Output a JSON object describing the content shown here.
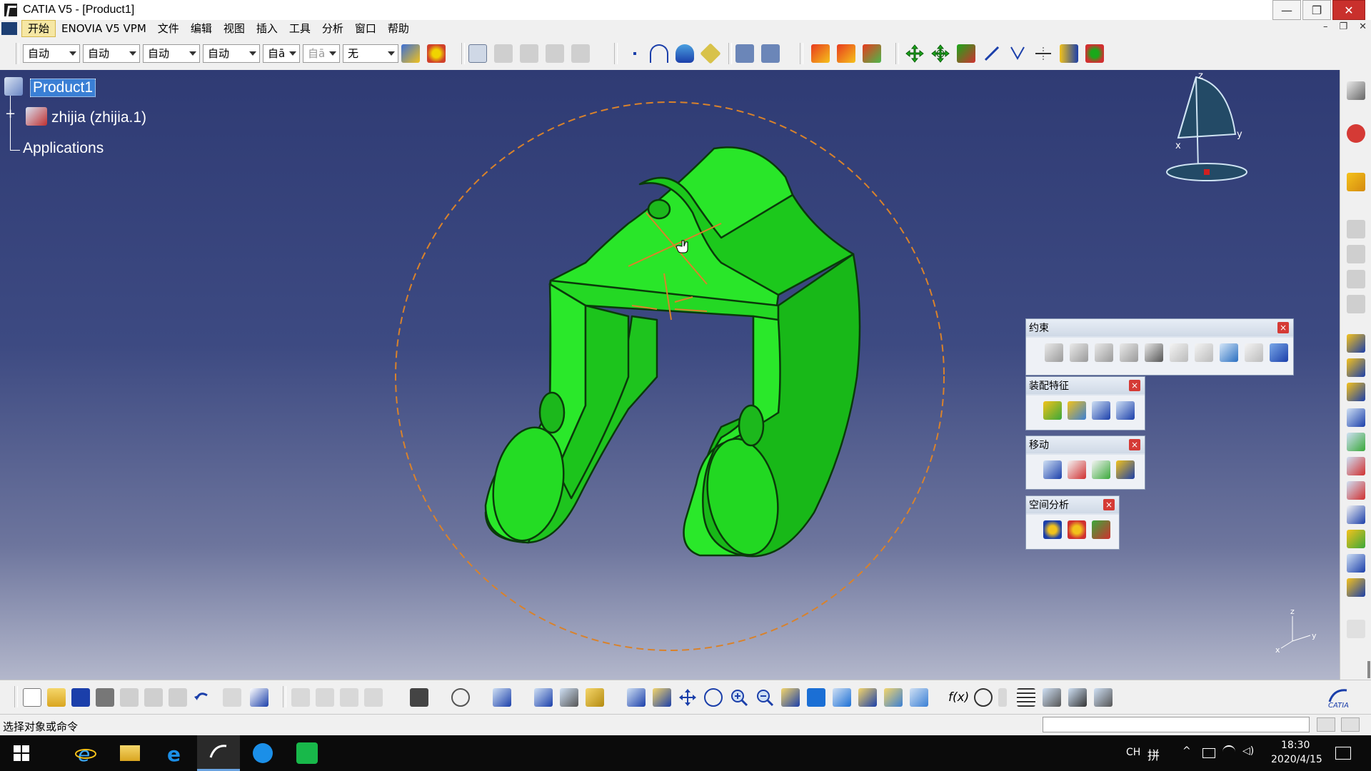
{
  "window": {
    "title": "CATIA V5 - [Product1]",
    "controls": {
      "minimize": "—",
      "restore": "❐",
      "close": "✕"
    }
  },
  "menubar": {
    "items": [
      "开始",
      "ENOVIA V5 VPM",
      "文件",
      "编辑",
      "视图",
      "插入",
      "工具",
      "分析",
      "窗口",
      "帮助"
    ],
    "active": "开始",
    "mdi": {
      "minimize": "–",
      "restore": "❐",
      "close": "✕"
    }
  },
  "toolbar_top": {
    "combos": [
      "自动",
      "自动",
      "自动",
      "自动",
      "自ā",
      "自ā",
      "无"
    ]
  },
  "tree": {
    "root": "Product1",
    "child": "zhijia (zhijia.1)",
    "applications": "Applications"
  },
  "compass": {
    "z": "z",
    "x": "x",
    "y": "y"
  },
  "axis_triad": {
    "z": "z",
    "y": "y",
    "x": "x"
  },
  "floating_toolbars": [
    {
      "title": "约束",
      "icons": [
        "coincidence-constraint-icon",
        "contact-constraint-icon",
        "offset-constraint-icon",
        "angle-constraint-icon",
        "fix-component-icon",
        "fix-together-icon",
        "quick-constraint-icon",
        "flexible-rigid-icon",
        "change-constraint-icon",
        "reuse-pattern-icon"
      ]
    },
    {
      "title": "装配特征",
      "icons": [
        "split-icon",
        "hole-icon",
        "pocket-icon",
        "remove-icon"
      ]
    },
    {
      "title": "移动",
      "icons": [
        "manipulation-icon",
        "snap-icon",
        "explode-icon",
        "stop-manipulate-icon"
      ]
    },
    {
      "title": "空间分析",
      "icons": [
        "clash-icon",
        "sectioning-icon",
        "distance-band-icon"
      ]
    }
  ],
  "statusbar": {
    "text": "选择对象或命令",
    "command_input": ""
  },
  "taskbar": {
    "apps": [
      "windows-start-icon",
      "internet-explorer-icon",
      "file-explorer-icon",
      "edge-icon",
      "catia-icon",
      "media-player-icon",
      "wechat-icon"
    ],
    "ime": "CH",
    "ime2": "拼",
    "time": "18:30",
    "date": "2020/4/15"
  },
  "colors": {
    "part_green": "#1fe01f",
    "part_edge": "#0a3a0a",
    "viewport_top": "#2f3b74",
    "viewport_bottom": "#b3b7cb",
    "sphere_dash": "#d9822b",
    "close_red": "#d53a35"
  }
}
